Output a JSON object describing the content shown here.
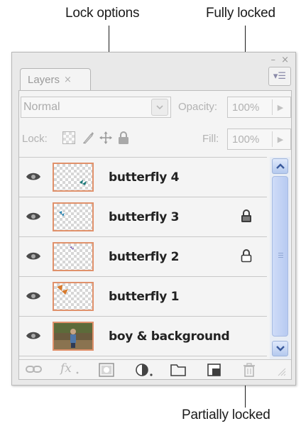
{
  "callouts": {
    "lock_options": "Lock options",
    "fully_locked": "Fully locked",
    "partially_locked": "Partially locked"
  },
  "panel": {
    "window_controls": "– ×",
    "tab": {
      "label": "Layers",
      "close": "×"
    },
    "menu_button": "▾☰",
    "blend_mode": "Normal",
    "opacity": {
      "label": "Opacity:",
      "value": "100%"
    },
    "lock": {
      "label": "Lock:",
      "options": [
        "lock-transparent-pixels-icon",
        "lock-image-pixels-icon",
        "lock-position-icon",
        "lock-all-icon"
      ]
    },
    "fill": {
      "label": "Fill:",
      "value": "100%"
    }
  },
  "layers": [
    {
      "name": "butterfly 4",
      "lock": "none"
    },
    {
      "name": "butterfly 3",
      "lock": "full"
    },
    {
      "name": "butterfly 2",
      "lock": "partial"
    },
    {
      "name": "butterfly 1",
      "lock": "none"
    },
    {
      "name": "boy & background",
      "lock": "none"
    }
  ],
  "bottom_icons": [
    "link-layers-icon",
    "fx-layer-style-icon",
    "add-layer-mask-icon",
    "adjustment-layer-icon",
    "new-group-icon",
    "new-layer-icon",
    "trash-icon"
  ],
  "colors": {
    "panel_bg": "#e9e9e9",
    "thumb_border": "#e0916b",
    "scrollbar": "#b7caf1",
    "disabled_text": "#b2b2b2"
  }
}
